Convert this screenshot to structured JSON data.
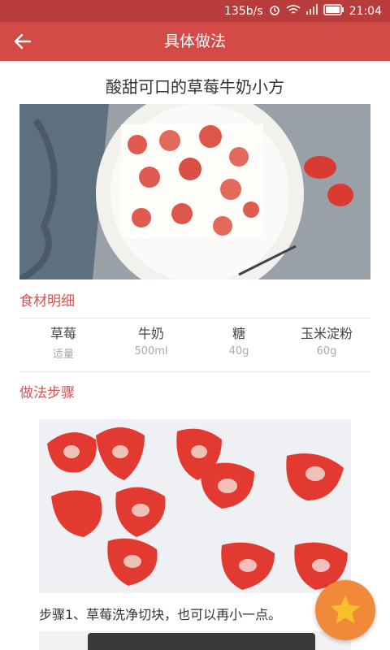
{
  "status_bar": {
    "speed": "135b/s",
    "time": "21:04",
    "icons": [
      "alarm-icon",
      "wifi-icon",
      "signal-icon",
      "battery-icon"
    ]
  },
  "app_bar": {
    "title": "具体做法",
    "back_icon": "arrow-left-icon"
  },
  "recipe": {
    "title": "酸甜可口的草莓牛奶小方"
  },
  "ingredients_section": {
    "title": "食材明细",
    "items": [
      {
        "name": "草莓",
        "amount": "适量"
      },
      {
        "name": "牛奶",
        "amount": "500ml"
      },
      {
        "name": "糖",
        "amount": "40g"
      },
      {
        "name": "玉米淀粉",
        "amount": "60g"
      }
    ]
  },
  "steps_section": {
    "title": "做法步骤",
    "steps": [
      {
        "text": "步骤1、草莓洗净切块，也可以再小一点。"
      }
    ]
  },
  "fab": {
    "icon": "star-icon"
  },
  "colors": {
    "status_bar": "#b93c3c",
    "app_bar": "#d34a46",
    "accent": "#d9534f",
    "fab": "#f08a3a",
    "star": "#f7c02b"
  }
}
